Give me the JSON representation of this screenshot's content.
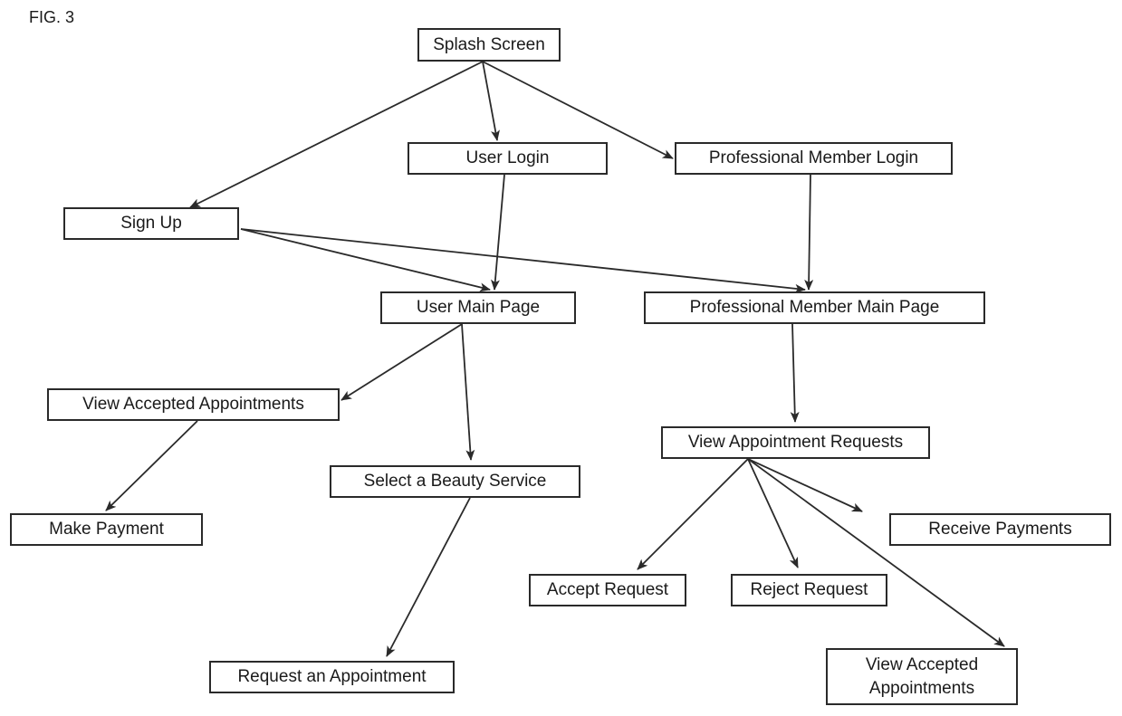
{
  "figure_label": "FIG. 3",
  "diagram": {
    "type": "flowchart",
    "nodes": [
      {
        "id": "splash",
        "label": "Splash Screen"
      },
      {
        "id": "user_login",
        "label": "User Login"
      },
      {
        "id": "pro_login",
        "label": "Professional Member Login"
      },
      {
        "id": "sign_up",
        "label": "Sign Up"
      },
      {
        "id": "user_main",
        "label": "User Main Page"
      },
      {
        "id": "pro_main",
        "label": "Professional Member Main Page"
      },
      {
        "id": "view_accepted_user",
        "label": "View Accepted Appointments"
      },
      {
        "id": "select_service",
        "label": "Select a Beauty Service"
      },
      {
        "id": "make_payment",
        "label": "Make Payment"
      },
      {
        "id": "request_appt",
        "label": "Request an Appointment"
      },
      {
        "id": "view_requests",
        "label": "View Appointment Requests"
      },
      {
        "id": "receive_payments",
        "label": "Receive Payments"
      },
      {
        "id": "accept_request",
        "label": "Accept Request"
      },
      {
        "id": "reject_request",
        "label": "Reject Request"
      },
      {
        "id": "view_accepted_pro",
        "label": "View Accepted\nAppointments"
      }
    ],
    "edges": [
      {
        "from": "splash",
        "to": "sign_up"
      },
      {
        "from": "splash",
        "to": "user_login"
      },
      {
        "from": "splash",
        "to": "pro_login"
      },
      {
        "from": "user_login",
        "to": "user_main"
      },
      {
        "from": "pro_login",
        "to": "pro_main"
      },
      {
        "from": "sign_up",
        "to": "user_main"
      },
      {
        "from": "sign_up",
        "to": "pro_main"
      },
      {
        "from": "user_main",
        "to": "view_accepted_user"
      },
      {
        "from": "user_main",
        "to": "select_service"
      },
      {
        "from": "view_accepted_user",
        "to": "make_payment"
      },
      {
        "from": "select_service",
        "to": "request_appt"
      },
      {
        "from": "pro_main",
        "to": "view_requests"
      },
      {
        "from": "view_requests",
        "to": "accept_request"
      },
      {
        "from": "view_requests",
        "to": "reject_request"
      },
      {
        "from": "view_requests",
        "to": "view_accepted_pro"
      },
      {
        "from": "view_requests",
        "to": "receive_payments"
      }
    ]
  }
}
